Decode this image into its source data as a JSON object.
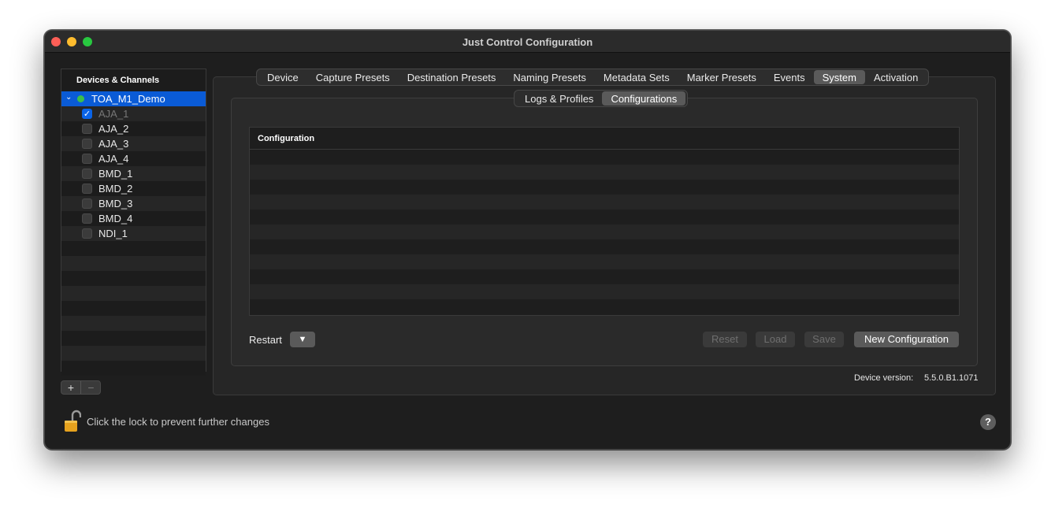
{
  "window": {
    "title": "Just Control Configuration"
  },
  "sidebar": {
    "header": "Devices & Channels",
    "device": {
      "name": "TOA_M1_Demo",
      "status_color": "#3bbf4a",
      "expanded": true
    },
    "channels": [
      {
        "name": "AJA_1",
        "checked": true,
        "dimmed": true
      },
      {
        "name": "AJA_2",
        "checked": false
      },
      {
        "name": "AJA_3",
        "checked": false
      },
      {
        "name": "AJA_4",
        "checked": false
      },
      {
        "name": "BMD_1",
        "checked": false
      },
      {
        "name": "BMD_2",
        "checked": false
      },
      {
        "name": "BMD_3",
        "checked": false
      },
      {
        "name": "BMD_4",
        "checked": false
      },
      {
        "name": "NDI_1",
        "checked": false
      }
    ],
    "add_label": "+",
    "remove_label": "−"
  },
  "tabs": {
    "items": [
      "Device",
      "Capture Presets",
      "Destination Presets",
      "Naming Presets",
      "Metadata Sets",
      "Marker Presets",
      "Events",
      "System",
      "Activation"
    ],
    "active": "System"
  },
  "subtabs": {
    "items": [
      "Logs & Profiles",
      "Configurations"
    ],
    "active": "Configurations"
  },
  "table": {
    "column_header": "Configuration",
    "rows": []
  },
  "controls": {
    "restart_label": "Restart",
    "restart_dropdown_glyph": "▼",
    "reset_label": "Reset",
    "load_label": "Load",
    "save_label": "Save",
    "new_configuration_label": "New Configuration"
  },
  "footer": {
    "device_version_label": "Device version:",
    "device_version_value": "5.5.0.B1.1071",
    "lock_text": "Click the lock to prevent further changes",
    "help_label": "?"
  },
  "colors": {
    "accent": "#0a5bd6",
    "lock": "#e6a21e"
  }
}
